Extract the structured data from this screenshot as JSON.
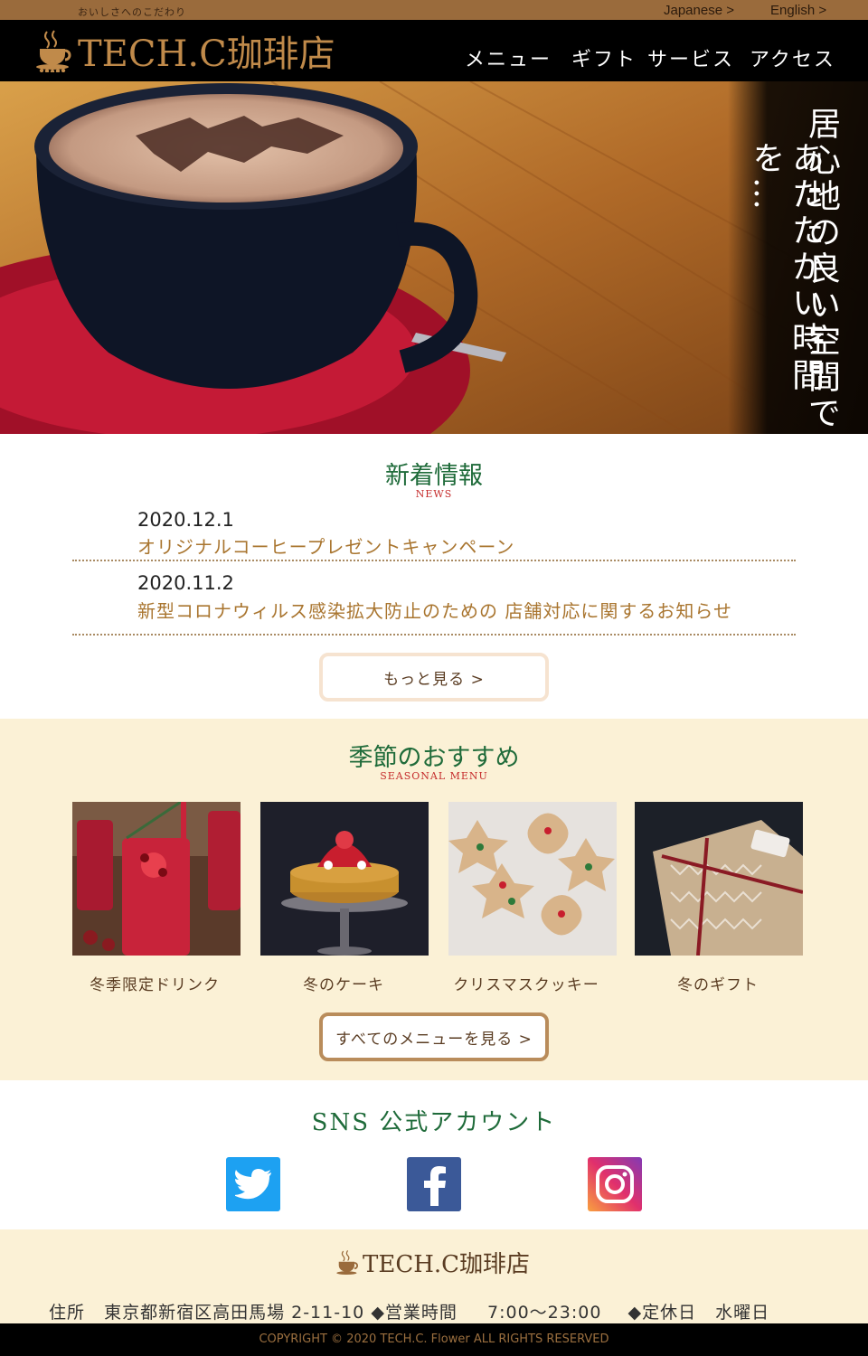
{
  "top": {
    "tagline": "おいしさへのこだわり",
    "lang_ja": "Japanese >",
    "lang_en": "English >"
  },
  "brand": {
    "name": "TECH.C珈琲店",
    "icon": "coffee-cup-logo-icon"
  },
  "nav": {
    "menu": "メニュー",
    "gift": "ギフト",
    "service": "サービス",
    "access": "アクセス"
  },
  "hero": {
    "line1": "居心地の良い空間で",
    "line2": "あたたかい時間を…"
  },
  "news": {
    "title": "新着情報",
    "subtitle": "NEWS",
    "items": [
      {
        "date": "2020.12.1",
        "title": "オリジナルコーヒープレゼントキャンペーン"
      },
      {
        "date": "2020.11.2",
        "title": "新型コロナウィルス感染拡大防止のための 店舗対応に関するお知らせ"
      }
    ],
    "more": "もっと見る >"
  },
  "seasonal": {
    "title": "季節のおすすめ",
    "subtitle": "SEASONAL MENU",
    "items": [
      {
        "label": "冬季限定ドリンク"
      },
      {
        "label": "冬のケーキ"
      },
      {
        "label": "クリスマスクッキー"
      },
      {
        "label": "冬のギフト"
      }
    ],
    "all": "すべてのメニューを見る >"
  },
  "sns": {
    "title": "SNS 公式アカウント",
    "twitter": "twitter-icon",
    "facebook": "facebook-icon",
    "instagram": "instagram-icon"
  },
  "footer": {
    "brand": "TECH.C珈琲店",
    "address_label": "住所",
    "address": "東京都新宿区高田馬場 2-11-10",
    "hours_label": "◆営業時間",
    "hours": "7:00～23:00",
    "closed_label": "◆定休日",
    "closed": "水曜日",
    "copyright": "COPYRIGHT © 2020 TECH.C. Flower ALL RIGHTS  RESERVED"
  },
  "colors": {
    "accent_brown": "#9a6b3c",
    "green": "#1f6b3a",
    "red": "#c52b2b",
    "cream": "#fbf1d6"
  }
}
